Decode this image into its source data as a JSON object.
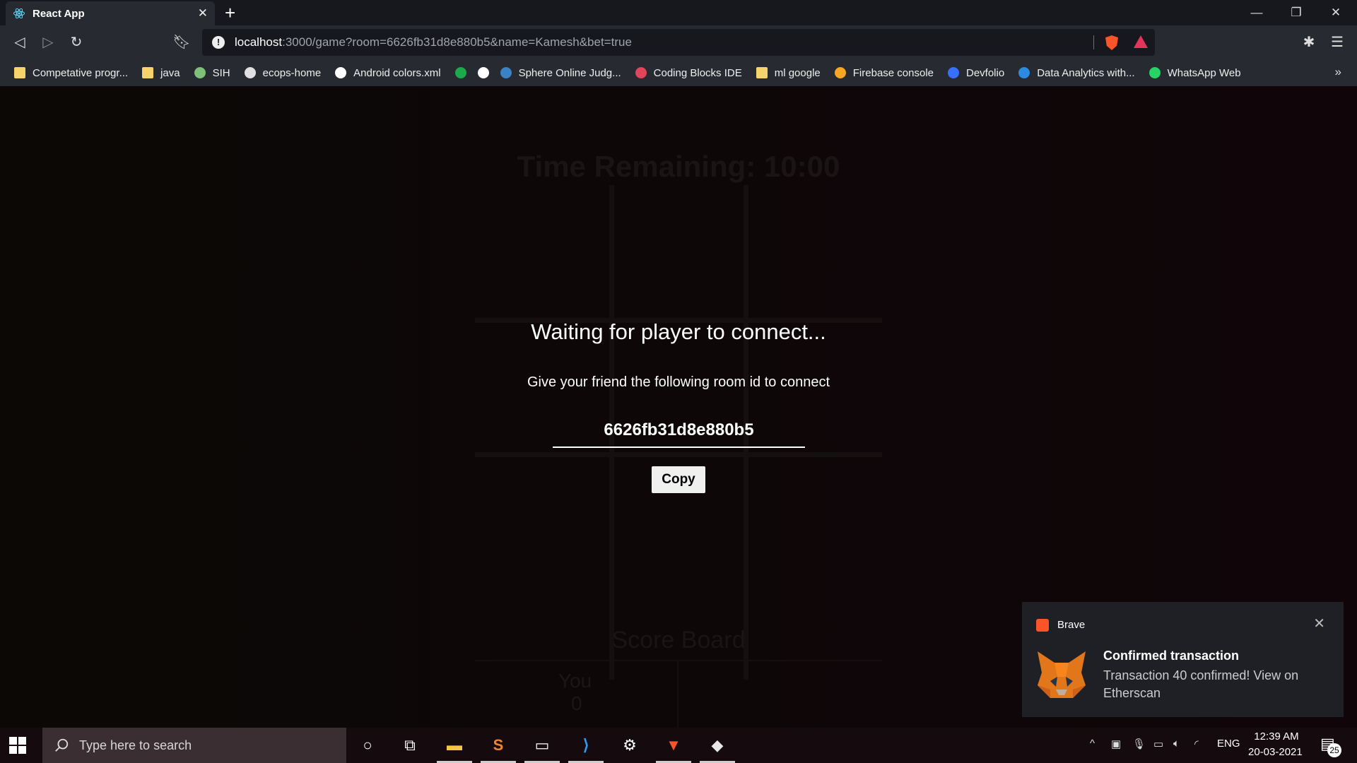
{
  "browser": {
    "tab_title": "React App",
    "tab_close": "✕",
    "new_tab": "+",
    "url_host": "localhost",
    "url_rest": ":3000/game?room=6626fb31d8e880b5&name=Kamesh&bet=true",
    "bookmarks": [
      {
        "label": "Competative progr...",
        "icon": "folder-icon",
        "color": "#f6d36b"
      },
      {
        "label": "java",
        "icon": "folder-icon",
        "color": "#f6d36b"
      },
      {
        "label": "SIH",
        "icon": "globe-icon",
        "color": "#7ec07a"
      },
      {
        "label": "ecops-home",
        "icon": "site-icon",
        "color": "#e0e0e0"
      },
      {
        "label": "Android colors.xml",
        "icon": "github-icon",
        "color": "#ffffff"
      },
      {
        "label": "",
        "icon": "hackerrank-icon",
        "color": "#1ba94c"
      },
      {
        "label": "",
        "icon": "globe-icon",
        "color": "#ffffff"
      },
      {
        "label": "Sphere Online Judg...",
        "icon": "spoj-icon",
        "color": "#3b82c4"
      },
      {
        "label": "Coding Blocks IDE",
        "icon": "cube-icon",
        "color": "#e0455b"
      },
      {
        "label": "ml google",
        "icon": "folder-icon",
        "color": "#f6d36b"
      },
      {
        "label": "Firebase console",
        "icon": "firebase-icon",
        "color": "#f5a623"
      },
      {
        "label": "Devfolio",
        "icon": "devfolio-icon",
        "color": "#3770ff"
      },
      {
        "label": "Data Analytics with...",
        "icon": "s-icon",
        "color": "#2b8ae2"
      },
      {
        "label": "WhatsApp Web",
        "icon": "whatsapp-icon",
        "color": "#25d366"
      }
    ],
    "bookmarks_more": "»"
  },
  "game": {
    "time_remaining": "Time Remaining: 10:00",
    "scoreboard_title": "Score Board",
    "score_label": "You",
    "score_value": "0"
  },
  "modal": {
    "heading": "Waiting for player to connect...",
    "subheading": "Give your friend the following room id to connect",
    "room_id": "6626fb31d8e880b5",
    "copy_label": "Copy"
  },
  "notification": {
    "app": "Brave",
    "title": "Confirmed transaction",
    "body": "Transaction 40 confirmed! View on Etherscan",
    "close": "✕"
  },
  "taskbar": {
    "search_placeholder": "Type here to search",
    "language": "ENG",
    "time": "12:39 AM",
    "date": "20-03-2021",
    "notification_count": "25"
  }
}
